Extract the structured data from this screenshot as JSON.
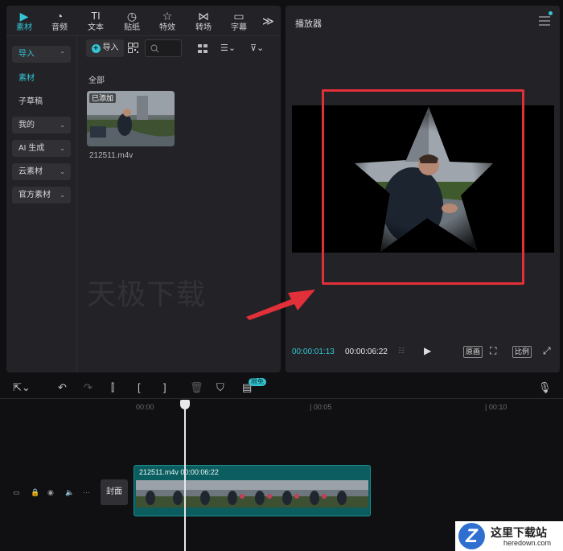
{
  "tabs": [
    {
      "label": "素材",
      "icon": "media-icon",
      "active": true
    },
    {
      "label": "音频",
      "icon": "audio-icon"
    },
    {
      "label": "文本",
      "icon": "text-icon"
    },
    {
      "label": "贴纸",
      "icon": "sticker-icon"
    },
    {
      "label": "特效",
      "icon": "effects-icon"
    },
    {
      "label": "转场",
      "icon": "transition-icon"
    },
    {
      "label": "字幕",
      "icon": "subtitle-icon"
    }
  ],
  "tabs_more": "≫",
  "side_nav": [
    {
      "label": "导入",
      "boxed": true,
      "selected": true
    },
    {
      "label": "素材",
      "boxed": false,
      "selected": true
    },
    {
      "label": "子草稿",
      "boxed": false
    },
    {
      "label": "我的",
      "boxed": true
    },
    {
      "label": "AI 生成",
      "boxed": true
    },
    {
      "label": "云素材",
      "boxed": true
    },
    {
      "label": "官方素材",
      "boxed": true
    }
  ],
  "media": {
    "import_label": "导入",
    "all_label": "全部",
    "clip_badge": "已添加",
    "clip_name": "212511.m4v",
    "watermark": "天极下载"
  },
  "player": {
    "title": "播放器",
    "time_current": "00:00:01:13",
    "time_total": "00:00:06:22",
    "original_label": "原画",
    "ratio_label": "比例"
  },
  "timeline": {
    "badge": "限免",
    "ruler": [
      "00:00",
      "| 00:05",
      "| 00:10"
    ],
    "cover_label": "封面",
    "clip_label": "212511.m4v   00:00:06:22"
  },
  "site_logo": {
    "cn": "这里下载站",
    "en": "heredown.com"
  },
  "colors": {
    "accent": "#33c6d4",
    "highlight_frame": "#e2303a",
    "arrow": "#e2303a"
  }
}
